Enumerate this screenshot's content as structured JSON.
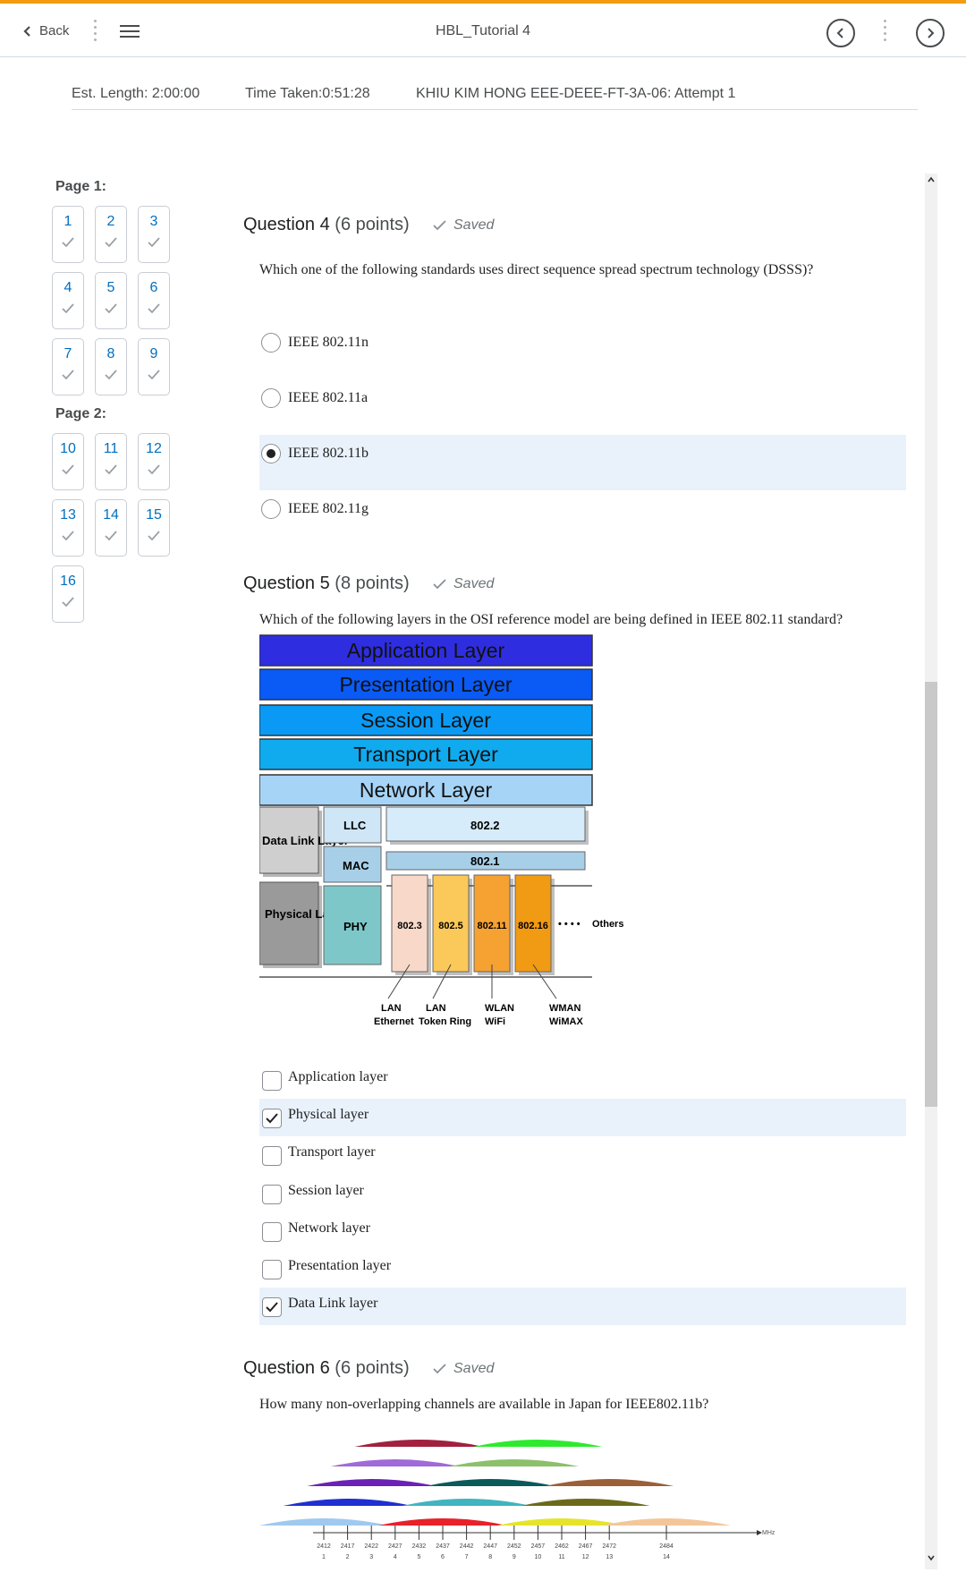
{
  "header": {
    "back_label": "Back",
    "title": "HBL_Tutorial 4",
    "icons": [
      "chevron-left-icon",
      "vertical-dots-icon",
      "menu-icon",
      "previous-circle-icon",
      "next-circle-icon"
    ]
  },
  "info": {
    "est_length": "Est. Length: 2:00:00",
    "time_taken": "Time Taken:0:51:28",
    "attempt": "KHIU KIM HONG EEE-DEEE-FT-3A-06: Attempt 1"
  },
  "nav": {
    "page1_label": "Page 1:",
    "page2_label": "Page 2:",
    "page1": [
      "1",
      "2",
      "3",
      "4",
      "5",
      "6",
      "7",
      "8",
      "9"
    ],
    "page2": [
      "10",
      "11",
      "12",
      "13",
      "14",
      "15",
      "16"
    ]
  },
  "q4": {
    "title": "Question 4",
    "points": "(6 points)",
    "saved": "Saved",
    "text": "Which one of the following standards uses direct sequence spread spectrum technology (DSSS)?",
    "options": [
      "IEEE 802.11n",
      "IEEE 802.11a",
      "IEEE 802.11b",
      "IEEE 802.11g"
    ],
    "selected": 2
  },
  "q5": {
    "title": "Question 5",
    "points": "(8 points)",
    "saved": "Saved",
    "text": "Which of the following layers in the OSI reference model are being defined in IEEE 802.11 standard?",
    "diagram": {
      "layers": [
        "Application Layer",
        "Presentation Layer",
        "Session Layer",
        "Transport Layer",
        "Network Layer"
      ],
      "datalink": "Data Link Layer",
      "physical": "Physical Layer",
      "llc": "LLC",
      "mac": "MAC",
      "phy": "PHY",
      "s8022": "802.2",
      "s8021": "802.1",
      "stds": [
        "802.3",
        "802.5",
        "802.11",
        "802.16"
      ],
      "others": "Others",
      "labels1": [
        "LAN",
        "LAN",
        "WLAN",
        "WMAN"
      ],
      "labels2": [
        "Ethernet",
        "Token Ring",
        "WiFi",
        "WiMAX"
      ]
    },
    "options": [
      "Application layer",
      "Physical layer",
      "Transport layer",
      "Session layer",
      "Network layer",
      "Presentation layer",
      "Data Link layer"
    ],
    "checked": [
      false,
      true,
      false,
      false,
      false,
      false,
      true
    ]
  },
  "q6": {
    "title": "Question 6",
    "points": "(6 points)",
    "saved": "Saved",
    "text": "How many non-overlapping channels are available in Japan for IEEE802.11b?",
    "unit": "MHz",
    "freqs": [
      "2412",
      "2417",
      "2422",
      "2427",
      "2432",
      "2437",
      "2442",
      "2447",
      "2452",
      "2457",
      "2462",
      "2467",
      "2472",
      "2484"
    ],
    "channels": [
      "1",
      "2",
      "3",
      "4",
      "5",
      "6",
      "7",
      "8",
      "9",
      "10",
      "11",
      "12",
      "13",
      "14"
    ],
    "colors": [
      "#9fc9ef",
      "#1f2fd1",
      "#6b21b5",
      "#a06ad9",
      "#a12040",
      "#e8212a",
      "#40b4c0",
      "#0a5a5a",
      "#8cc06a",
      "#2eea2e",
      "#e5e42a",
      "#6a6a1a",
      "#9b6038",
      "#f3c69a"
    ]
  }
}
